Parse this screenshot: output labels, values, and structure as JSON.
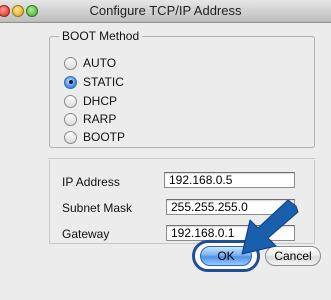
{
  "window": {
    "title": "Configure TCP/IP Address"
  },
  "boot_method": {
    "label": "BOOT Method",
    "options": [
      {
        "label": "AUTO",
        "selected": false
      },
      {
        "label": "STATIC",
        "selected": true
      },
      {
        "label": "DHCP",
        "selected": false
      },
      {
        "label": "RARP",
        "selected": false
      },
      {
        "label": "BOOTP",
        "selected": false
      }
    ]
  },
  "network": {
    "ip_label": "IP Address",
    "ip_value": "192.168.0.5",
    "subnet_label": "Subnet Mask",
    "subnet_value": "255.255.255.0",
    "gateway_label": "Gateway",
    "gateway_value": "192.168.0.1"
  },
  "buttons": {
    "ok_label": "OK",
    "cancel_label": "Cancel"
  },
  "colors": {
    "callout_arrow": "#1a5fae",
    "ok_highlight_ring": "#1f4f9a"
  },
  "annotations": {
    "arrow_icon": "arrow-pointing-to-ok-icon"
  }
}
